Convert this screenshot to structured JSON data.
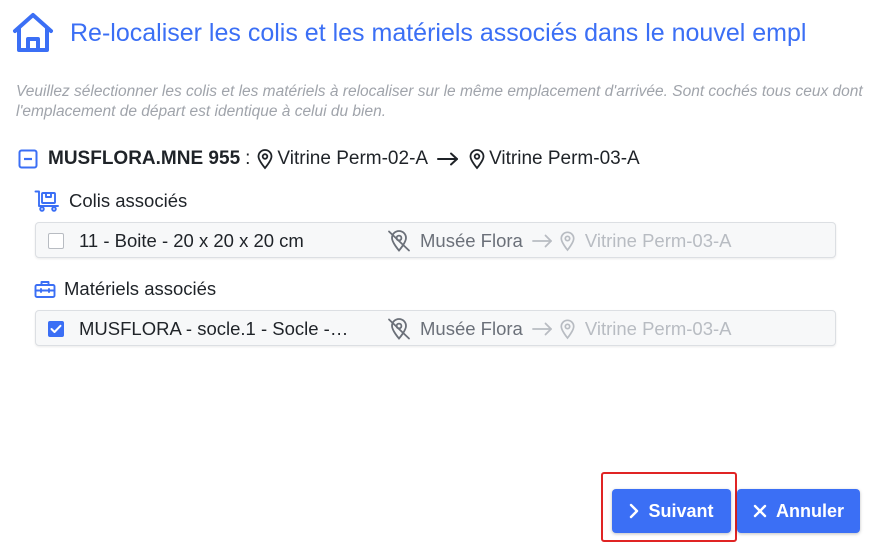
{
  "header": {
    "title": "Re-localiser les colis et les matériels associés dans le nouvel empl",
    "icon": "home-icon"
  },
  "description": "Veuillez sélectionner les colis et les matériels à relocaliser sur le même emplacement d'arrivée. Sont cochés tous ceux dont l'emplacement de départ est identique à celui du bien.",
  "bien": {
    "code": "MUSFLORA.MNE 955",
    "separator": ":",
    "from": "Vitrine Perm-02-A",
    "to": "Vitrine Perm-03-A"
  },
  "colis": {
    "heading": "Colis associés",
    "items": [
      {
        "label": "11 - Boite - 20 x 20 x 20 cm",
        "checked": false,
        "from": "Musée Flora",
        "to": "Vitrine Perm-03-A"
      }
    ]
  },
  "materiels": {
    "heading": "Matériels associés",
    "items": [
      {
        "label": "MUSFLORA - socle.1 - Socle -…",
        "checked": true,
        "from": "Musée Flora",
        "to": "Vitrine Perm-03-A"
      }
    ]
  },
  "actions": {
    "next_label": "Suivant",
    "cancel_label": "Annuler"
  },
  "colors": {
    "accent": "#3b6ff5",
    "highlight": "#e02424"
  }
}
